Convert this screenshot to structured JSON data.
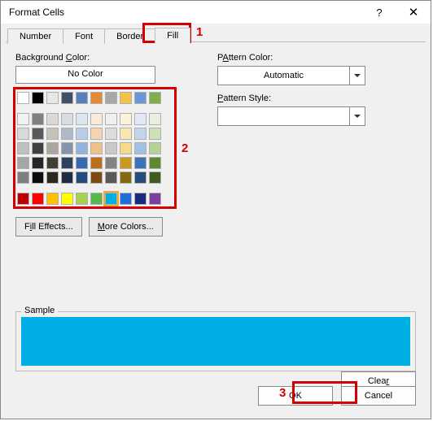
{
  "window": {
    "title": "Format Cells",
    "help": "?",
    "close": "✕"
  },
  "tabs": [
    {
      "id": "number",
      "label": "Number"
    },
    {
      "id": "font",
      "label": "Font"
    },
    {
      "id": "border",
      "label": "Border"
    },
    {
      "id": "fill",
      "label": "Fill",
      "active": true
    }
  ],
  "labels": {
    "background": "Background Color:",
    "background_u": "C",
    "pattern_color": "Pattern Color:",
    "pattern_color_u": "A",
    "pattern_style": "Pattern Style:",
    "pattern_style_u": "P",
    "sample": "Sample"
  },
  "nocolor": "No Color",
  "pattern_color_value": "Automatic",
  "buttons": {
    "fill_effects": "Fill Effects...",
    "more_colors": "More Colors...",
    "clear": "Clear",
    "ok": "OK",
    "cancel": "Cancel"
  },
  "sample_color": "#00aee6",
  "annotations": {
    "n1": "1",
    "n2": "2",
    "n3": "3"
  },
  "palette": {
    "top": [
      "#ffffff",
      "#000000",
      "#e8e8e8",
      "#425066",
      "#5680bc",
      "#e48a36",
      "#a8a8a8",
      "#f2c24a",
      "#6a98d6",
      "#7fae4a"
    ],
    "shades": [
      [
        "#f2f2f2",
        "#808080",
        "#dad9d6",
        "#d7dce4",
        "#dbe6f4",
        "#faead8",
        "#efefef",
        "#fcf2d8",
        "#e0eaf6",
        "#e6f0db"
      ],
      [
        "#d9d9d9",
        "#595959",
        "#c5c2bc",
        "#aeb8c8",
        "#b7cde9",
        "#f5d5b1",
        "#dcdcdc",
        "#f9e6b1",
        "#c1d5ed",
        "#cde1b7"
      ],
      [
        "#bfbfbf",
        "#404040",
        "#aaa69d",
        "#8593ab",
        "#93b3de",
        "#f0c08a",
        "#c9c9c9",
        "#f6d98a",
        "#a2c0e4",
        "#b4d293"
      ],
      [
        "#a6a6a6",
        "#262626",
        "#413e35",
        "#304160",
        "#356ab0",
        "#bb6f1c",
        "#838383",
        "#c99a1c",
        "#3a73b8",
        "#5e8a2e"
      ],
      [
        "#7f7f7f",
        "#0d0d0d",
        "#2b2920",
        "#1f2b40",
        "#244a7c",
        "#7d4a12",
        "#595959",
        "#866712",
        "#274d7c",
        "#3f5c1f"
      ]
    ],
    "standard": [
      "#c00000",
      "#ff0000",
      "#ffc000",
      "#ffff00",
      "#a6d252",
      "#54b948",
      "#00aee6",
      "#1f6fd8",
      "#1a2a80",
      "#7c3fa0"
    ],
    "selected": "#00aee6"
  }
}
